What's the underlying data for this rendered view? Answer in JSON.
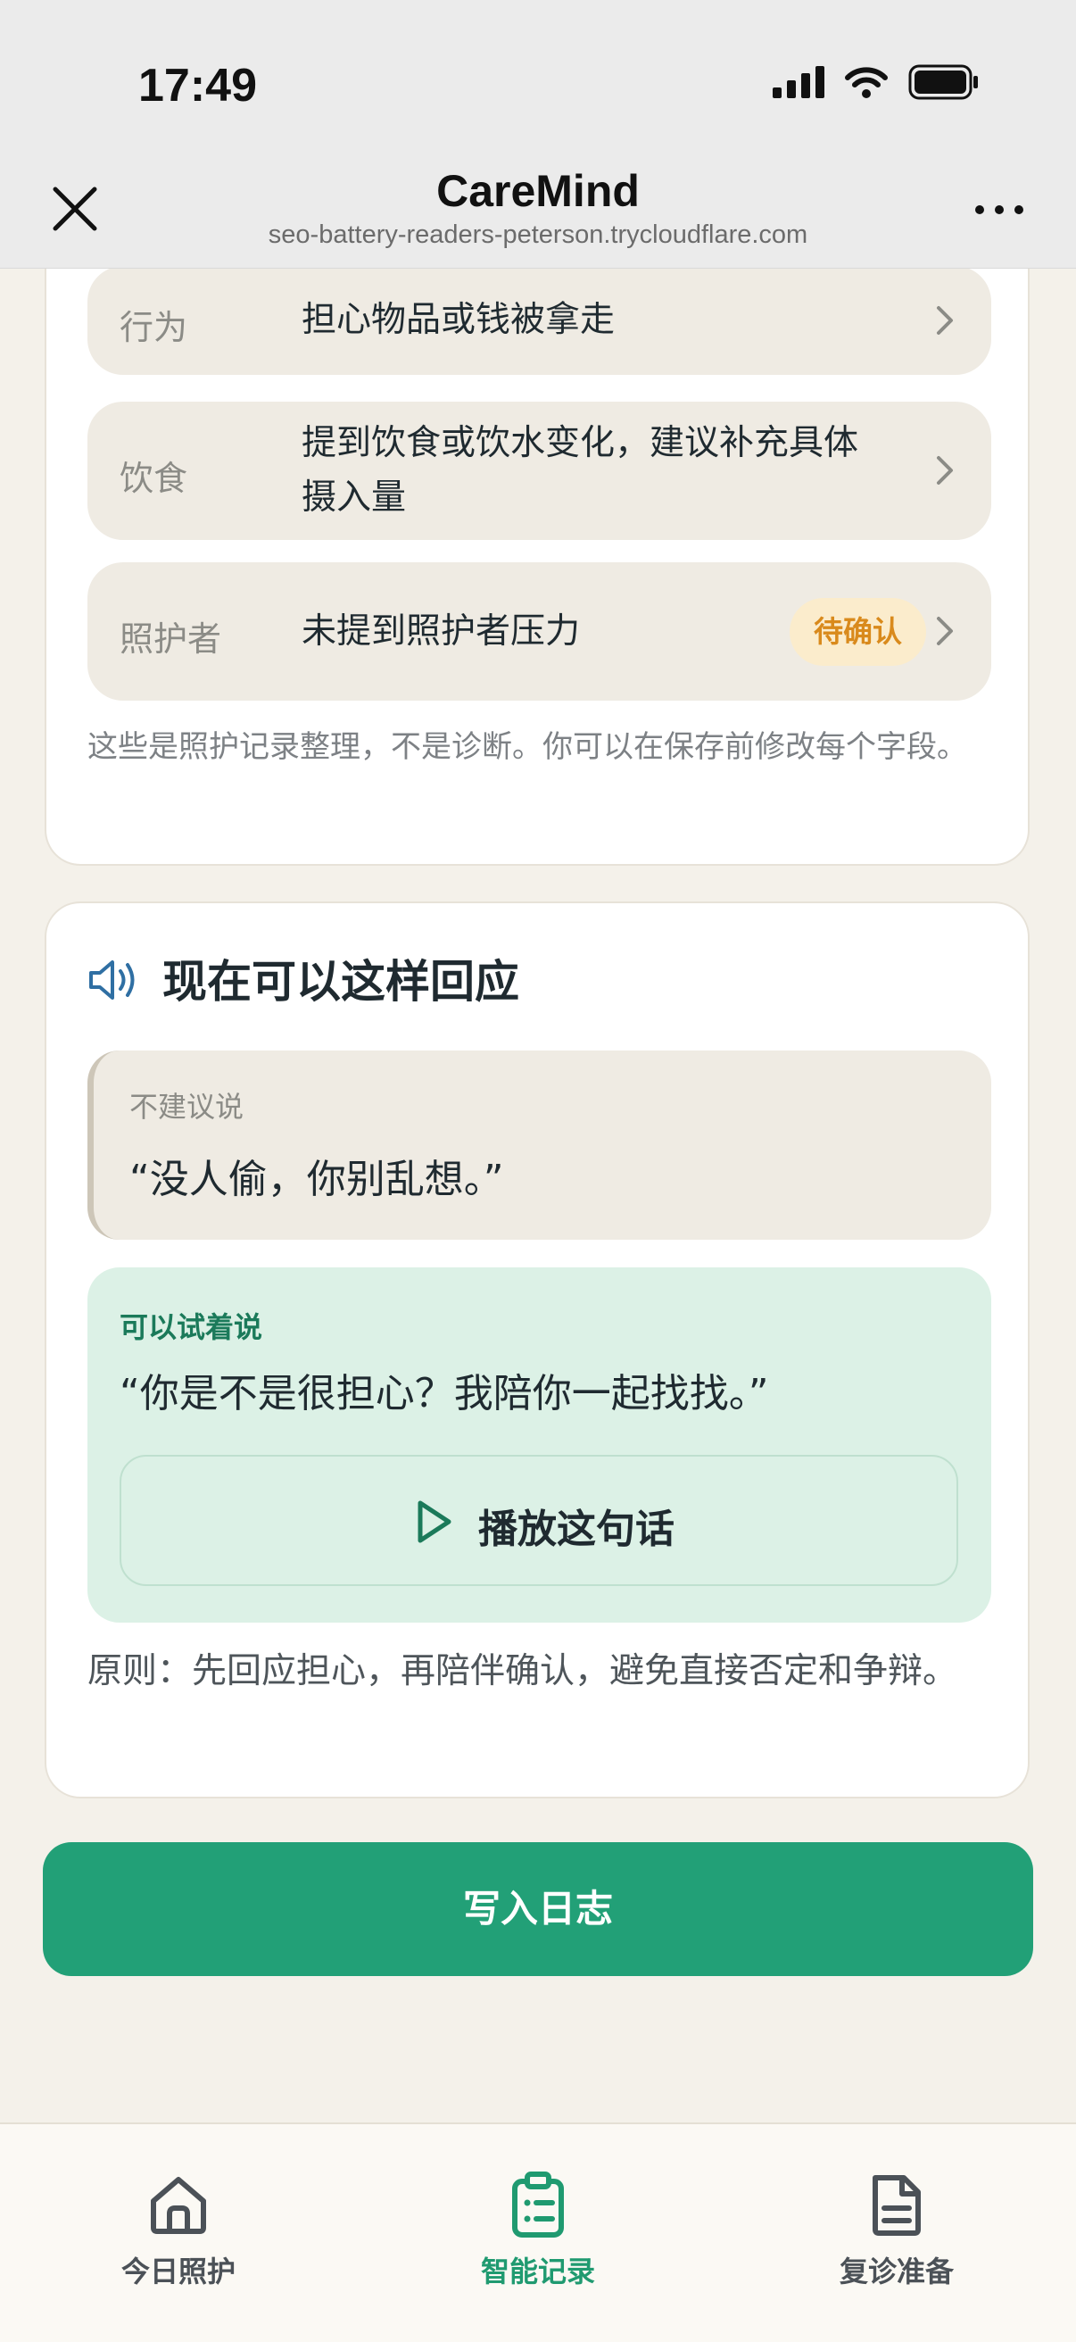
{
  "status_bar": {
    "time": "17:49"
  },
  "browser": {
    "title": "CareMind",
    "url": "seo-battery-readers-peterson.trycloudflare.com"
  },
  "record": {
    "rows": [
      {
        "label": "行为",
        "value": "担心物品或钱被拿走"
      },
      {
        "label": "饮食",
        "value": "提到饮食或饮水变化，建议补充具体摄入量"
      },
      {
        "label": "照护者",
        "value": "未提到照护者压力",
        "badge": "待确认"
      }
    ],
    "note": "这些是照护记录整理，不是诊断。你可以在保存前修改每个字段。"
  },
  "response": {
    "title": "现在可以这样回应",
    "avoid": {
      "caption": "不建议说",
      "quote": "“没人偷，你别乱想。”"
    },
    "suggest": {
      "caption": "可以试着说",
      "quote": "“你是不是很担心？我陪你一起找找。”",
      "play_label": "播放这句话"
    },
    "principle": "原则：先回应担心，再陪伴确认，避免直接否定和争辩。"
  },
  "primary_action": {
    "label": "写入日志"
  },
  "tabs": [
    {
      "label": "今日照护",
      "icon": "home-icon",
      "active": false
    },
    {
      "label": "智能记录",
      "icon": "clipboard-icon",
      "active": true
    },
    {
      "label": "复诊准备",
      "icon": "document-icon",
      "active": false
    }
  ],
  "colors": {
    "accent": "#22a077",
    "badge_text": "#d98a1c",
    "badge_bg": "#fbeccc",
    "suggest_bg": "#dcf1e6"
  }
}
